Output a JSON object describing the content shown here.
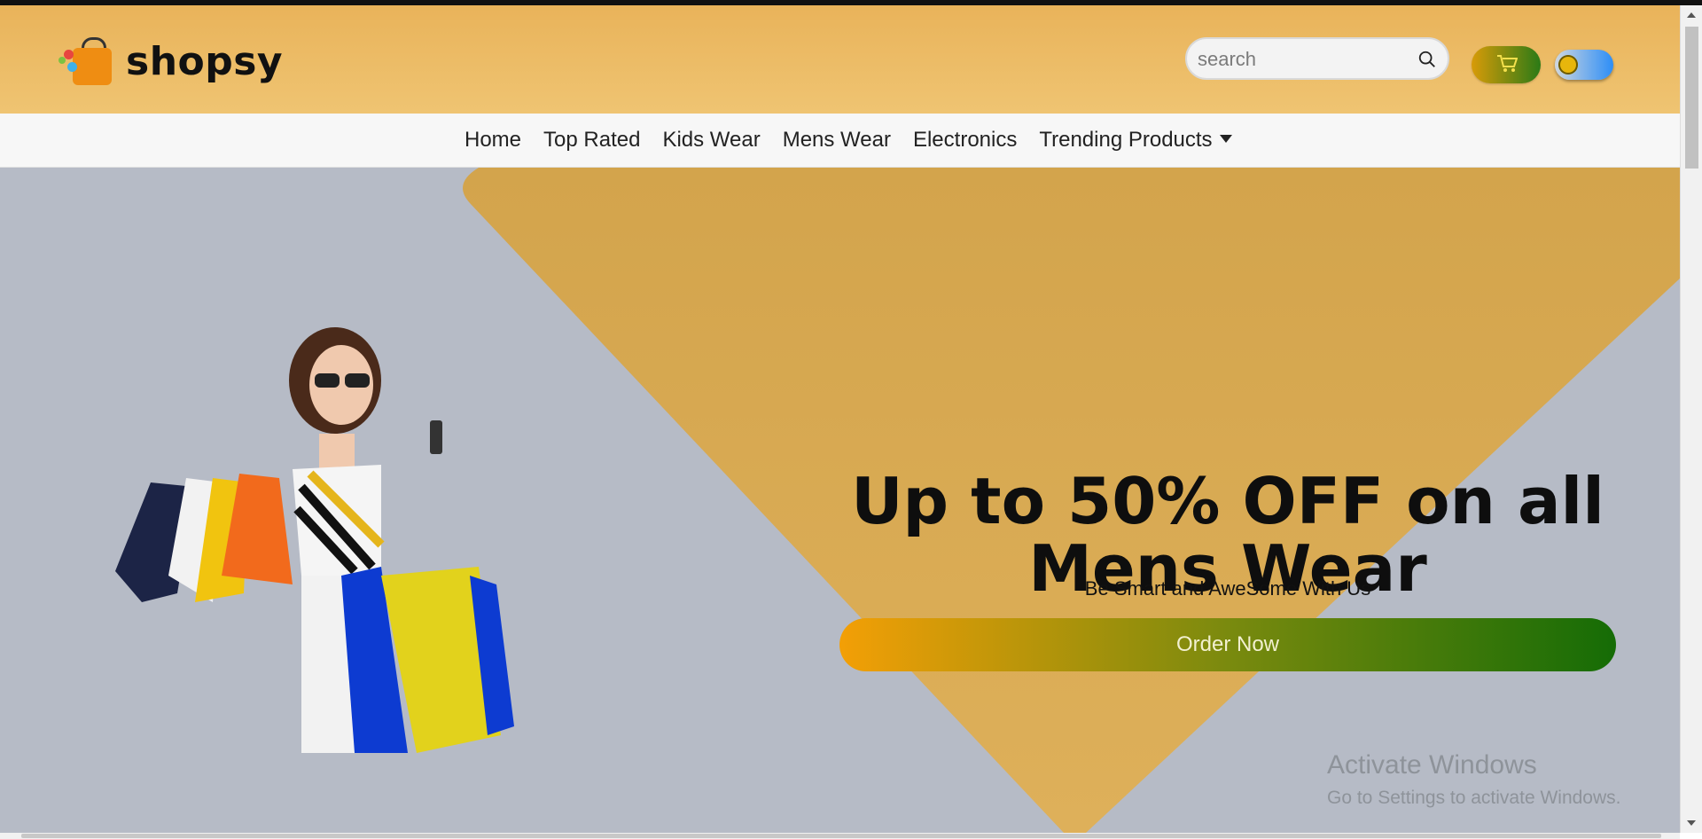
{
  "brand": {
    "name": "shopsy"
  },
  "search": {
    "placeholder": "search",
    "icon": "search-icon"
  },
  "header_controls": {
    "cart_icon": "cart-icon",
    "theme_toggle_icon": "theme-toggle"
  },
  "nav": {
    "items": [
      "Home",
      "Top Rated",
      "Kids Wear",
      "Mens Wear",
      "Electronics",
      "Trending Products"
    ],
    "dropdown_icon": "caret-down-icon"
  },
  "hero": {
    "headline": "Up to 50% OFF on all Mens Wear",
    "subtitle": "Be Smart and AweSome With Us",
    "cta": "Order Now",
    "image_icon": "woman-with-shopping-bags-image"
  },
  "watermark": {
    "line1": "Activate Windows",
    "line2": "Go to Settings to activate Windows."
  },
  "colors": {
    "header_bg": "#e9b35a",
    "accent_orange": "#f39f06",
    "accent_green": "#156c06",
    "hero_bg": "#b6bbc6",
    "hero_shape": "#d8a849"
  }
}
